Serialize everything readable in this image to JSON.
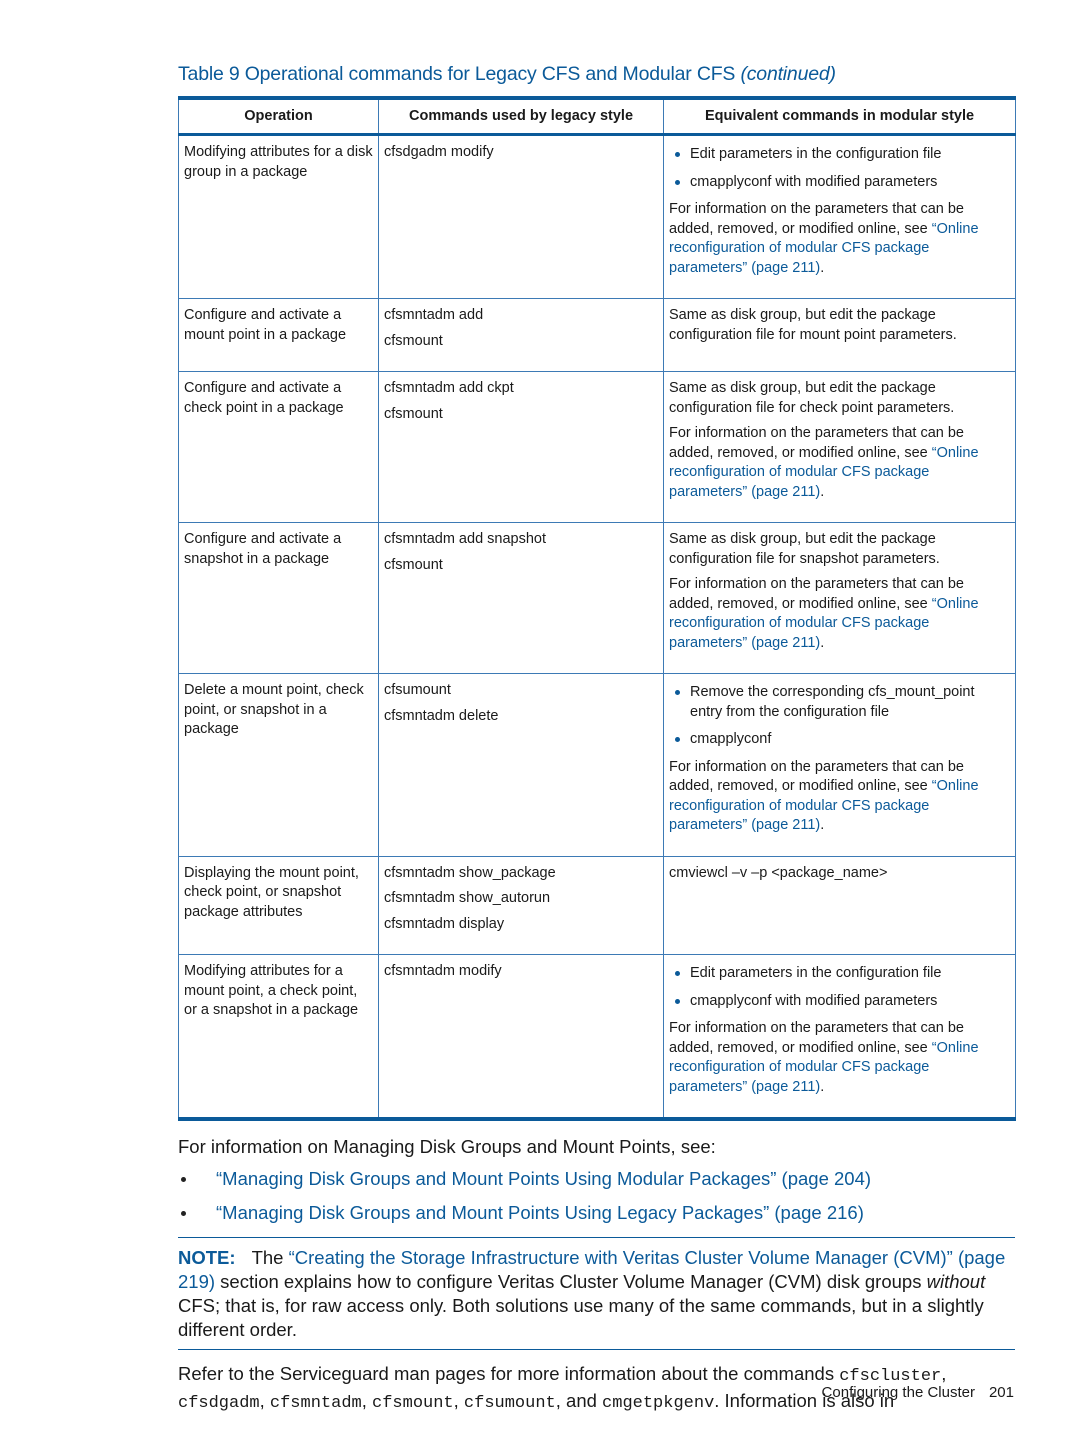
{
  "table": {
    "title_prefix": "Table 9 Operational commands for Legacy CFS and Modular CFS ",
    "title_suffix": "(continued)",
    "headers": [
      "Operation",
      "Commands used by legacy style",
      "Equivalent commands in modular style"
    ],
    "online_info": {
      "text": "For information on the parameters that can be added, removed, or modified online, see ",
      "link": "“Online reconfiguration of modular CFS package parameters” (page 211)",
      "end": "."
    },
    "rows": [
      {
        "operation": "Modifying attributes for a disk group in a package",
        "legacy": [
          "cfsdgadm modify"
        ],
        "modular_bullets": [
          "Edit parameters in the configuration file",
          "cmapplyconf with modified parameters"
        ],
        "modular_text": ""
      },
      {
        "operation": "Configure and activate a mount point in a package",
        "legacy": [
          "cfsmntadm add",
          "cfsmount"
        ],
        "modular_bullets": [],
        "modular_text": "Same as disk group, but edit the package configuration file for mount point parameters."
      },
      {
        "operation": "Configure and activate a check point in a package",
        "legacy": [
          "cfsmntadm add ckpt",
          "cfsmount"
        ],
        "modular_bullets": [],
        "modular_text": "Same as disk group, but edit the package configuration file for check point parameters."
      },
      {
        "operation": "Configure and activate a snapshot in a package",
        "legacy": [
          "cfsmntadm add snapshot",
          "cfsmount"
        ],
        "modular_bullets": [],
        "modular_text": "Same as disk group, but edit the package configuration file for snapshot parameters."
      },
      {
        "operation": "Delete a mount point, check point, or snapshot in a package",
        "legacy": [
          "cfsumount",
          "cfsmntadm delete"
        ],
        "modular_bullets": [
          "Remove the corresponding cfs_mount_point entry from the configuration file",
          "cmapplyconf"
        ],
        "modular_text": ""
      },
      {
        "operation": "Displaying the mount point, check point, or snapshot package attributes",
        "legacy": [
          "cfsmntadm show_package",
          "cfsmntadm show_autorun",
          "cfsmntadm display"
        ],
        "modular_bullets": [],
        "modular_text": "cmviewcl –v –p <package_name>"
      },
      {
        "operation": "Modifying attributes for a mount point, a check point, or a snapshot in a package",
        "legacy": [
          "cfsmntadm modify"
        ],
        "modular_bullets": [
          "Edit parameters in the configuration file",
          "cmapplyconf with modified parameters"
        ],
        "modular_text": ""
      }
    ]
  },
  "body": {
    "intro": "For information on Managing Disk Groups and Mount Points, see:",
    "links": [
      "“Managing Disk Groups and Mount Points Using Modular Packages” (page 204)",
      "“Managing Disk Groups and Mount Points Using Legacy Packages” (page 216)"
    ],
    "note": {
      "label": "NOTE:",
      "pre": "The ",
      "link": "“Creating the Storage Infrastructure with Veritas Cluster Volume Manager (CVM)” (page 219)",
      "mid": " section explains how to configure Veritas Cluster Volume Manager (CVM) disk groups ",
      "italic": "without",
      "post": " CFS; that is, for raw access only. Both solutions use many of the same commands, but in a slightly different order."
    },
    "refer": {
      "pre": "Refer to the Serviceguard man pages for more information about the commands ",
      "cmd1": "cfscluster",
      "sep1": ", ",
      "cmd2": "cfsdgadm",
      "sep2": ", ",
      "cmd3": "cfsmntadm",
      "sep3": ", ",
      "cmd4": "cfsmount",
      "sep4": ", ",
      "cmd5": "cfsumount",
      "sep5": ", and ",
      "cmd6": "cmgetpkgenv",
      "post": ". Information is also in"
    }
  },
  "footer": {
    "section": "Configuring the Cluster",
    "page_number": "201"
  },
  "colors": {
    "accent_blue": "#0b5a99",
    "grid_blue": "#3d7ab5",
    "text": "#1a1a1a"
  }
}
